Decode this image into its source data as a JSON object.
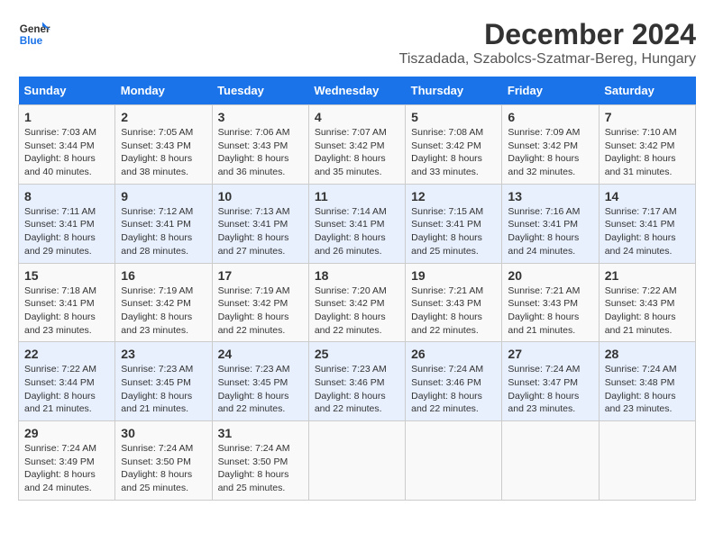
{
  "header": {
    "logo_text_general": "General",
    "logo_text_blue": "Blue",
    "main_title": "December 2024",
    "subtitle": "Tiszadada, Szabolcs-Szatmar-Bereg, Hungary"
  },
  "calendar": {
    "days_of_week": [
      "Sunday",
      "Monday",
      "Tuesday",
      "Wednesday",
      "Thursday",
      "Friday",
      "Saturday"
    ],
    "weeks": [
      [
        {
          "day": 1,
          "sunrise": "Sunrise: 7:03 AM",
          "sunset": "Sunset: 3:44 PM",
          "daylight": "Daylight: 8 hours and 40 minutes."
        },
        {
          "day": 2,
          "sunrise": "Sunrise: 7:05 AM",
          "sunset": "Sunset: 3:43 PM",
          "daylight": "Daylight: 8 hours and 38 minutes."
        },
        {
          "day": 3,
          "sunrise": "Sunrise: 7:06 AM",
          "sunset": "Sunset: 3:43 PM",
          "daylight": "Daylight: 8 hours and 36 minutes."
        },
        {
          "day": 4,
          "sunrise": "Sunrise: 7:07 AM",
          "sunset": "Sunset: 3:42 PM",
          "daylight": "Daylight: 8 hours and 35 minutes."
        },
        {
          "day": 5,
          "sunrise": "Sunrise: 7:08 AM",
          "sunset": "Sunset: 3:42 PM",
          "daylight": "Daylight: 8 hours and 33 minutes."
        },
        {
          "day": 6,
          "sunrise": "Sunrise: 7:09 AM",
          "sunset": "Sunset: 3:42 PM",
          "daylight": "Daylight: 8 hours and 32 minutes."
        },
        {
          "day": 7,
          "sunrise": "Sunrise: 7:10 AM",
          "sunset": "Sunset: 3:42 PM",
          "daylight": "Daylight: 8 hours and 31 minutes."
        }
      ],
      [
        {
          "day": 8,
          "sunrise": "Sunrise: 7:11 AM",
          "sunset": "Sunset: 3:41 PM",
          "daylight": "Daylight: 8 hours and 29 minutes."
        },
        {
          "day": 9,
          "sunrise": "Sunrise: 7:12 AM",
          "sunset": "Sunset: 3:41 PM",
          "daylight": "Daylight: 8 hours and 28 minutes."
        },
        {
          "day": 10,
          "sunrise": "Sunrise: 7:13 AM",
          "sunset": "Sunset: 3:41 PM",
          "daylight": "Daylight: 8 hours and 27 minutes."
        },
        {
          "day": 11,
          "sunrise": "Sunrise: 7:14 AM",
          "sunset": "Sunset: 3:41 PM",
          "daylight": "Daylight: 8 hours and 26 minutes."
        },
        {
          "day": 12,
          "sunrise": "Sunrise: 7:15 AM",
          "sunset": "Sunset: 3:41 PM",
          "daylight": "Daylight: 8 hours and 25 minutes."
        },
        {
          "day": 13,
          "sunrise": "Sunrise: 7:16 AM",
          "sunset": "Sunset: 3:41 PM",
          "daylight": "Daylight: 8 hours and 24 minutes."
        },
        {
          "day": 14,
          "sunrise": "Sunrise: 7:17 AM",
          "sunset": "Sunset: 3:41 PM",
          "daylight": "Daylight: 8 hours and 24 minutes."
        }
      ],
      [
        {
          "day": 15,
          "sunrise": "Sunrise: 7:18 AM",
          "sunset": "Sunset: 3:41 PM",
          "daylight": "Daylight: 8 hours and 23 minutes."
        },
        {
          "day": 16,
          "sunrise": "Sunrise: 7:19 AM",
          "sunset": "Sunset: 3:42 PM",
          "daylight": "Daylight: 8 hours and 23 minutes."
        },
        {
          "day": 17,
          "sunrise": "Sunrise: 7:19 AM",
          "sunset": "Sunset: 3:42 PM",
          "daylight": "Daylight: 8 hours and 22 minutes."
        },
        {
          "day": 18,
          "sunrise": "Sunrise: 7:20 AM",
          "sunset": "Sunset: 3:42 PM",
          "daylight": "Daylight: 8 hours and 22 minutes."
        },
        {
          "day": 19,
          "sunrise": "Sunrise: 7:21 AM",
          "sunset": "Sunset: 3:43 PM",
          "daylight": "Daylight: 8 hours and 22 minutes."
        },
        {
          "day": 20,
          "sunrise": "Sunrise: 7:21 AM",
          "sunset": "Sunset: 3:43 PM",
          "daylight": "Daylight: 8 hours and 21 minutes."
        },
        {
          "day": 21,
          "sunrise": "Sunrise: 7:22 AM",
          "sunset": "Sunset: 3:43 PM",
          "daylight": "Daylight: 8 hours and 21 minutes."
        }
      ],
      [
        {
          "day": 22,
          "sunrise": "Sunrise: 7:22 AM",
          "sunset": "Sunset: 3:44 PM",
          "daylight": "Daylight: 8 hours and 21 minutes."
        },
        {
          "day": 23,
          "sunrise": "Sunrise: 7:23 AM",
          "sunset": "Sunset: 3:45 PM",
          "daylight": "Daylight: 8 hours and 21 minutes."
        },
        {
          "day": 24,
          "sunrise": "Sunrise: 7:23 AM",
          "sunset": "Sunset: 3:45 PM",
          "daylight": "Daylight: 8 hours and 22 minutes."
        },
        {
          "day": 25,
          "sunrise": "Sunrise: 7:23 AM",
          "sunset": "Sunset: 3:46 PM",
          "daylight": "Daylight: 8 hours and 22 minutes."
        },
        {
          "day": 26,
          "sunrise": "Sunrise: 7:24 AM",
          "sunset": "Sunset: 3:46 PM",
          "daylight": "Daylight: 8 hours and 22 minutes."
        },
        {
          "day": 27,
          "sunrise": "Sunrise: 7:24 AM",
          "sunset": "Sunset: 3:47 PM",
          "daylight": "Daylight: 8 hours and 23 minutes."
        },
        {
          "day": 28,
          "sunrise": "Sunrise: 7:24 AM",
          "sunset": "Sunset: 3:48 PM",
          "daylight": "Daylight: 8 hours and 23 minutes."
        }
      ],
      [
        {
          "day": 29,
          "sunrise": "Sunrise: 7:24 AM",
          "sunset": "Sunset: 3:49 PM",
          "daylight": "Daylight: 8 hours and 24 minutes."
        },
        {
          "day": 30,
          "sunrise": "Sunrise: 7:24 AM",
          "sunset": "Sunset: 3:50 PM",
          "daylight": "Daylight: 8 hours and 25 minutes."
        },
        {
          "day": 31,
          "sunrise": "Sunrise: 7:24 AM",
          "sunset": "Sunset: 3:50 PM",
          "daylight": "Daylight: 8 hours and 25 minutes."
        },
        null,
        null,
        null,
        null
      ]
    ]
  }
}
